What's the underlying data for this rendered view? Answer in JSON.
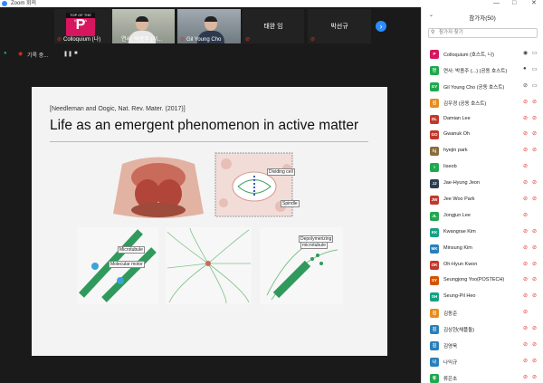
{
  "window": {
    "title": "Zoom 회의",
    "minimize": "—",
    "maximize": "□",
    "close": "✕"
  },
  "gallery": {
    "tiles": [
      {
        "name": "Colloquium (나)",
        "logo_top": "TOP OF THE KOREA",
        "logo_letter": "P"
      },
      {
        "name": "연사: 박종주 (서..."
      },
      {
        "name": "Gil Young Cho"
      },
      {
        "name": "태완 임"
      },
      {
        "name": "박선규"
      }
    ],
    "next_glyph": "›"
  },
  "recording": {
    "label": "기록 중...",
    "pause": "❚❚",
    "stop": "■"
  },
  "slide": {
    "citation": "[Needleman and Oogic, Nat. Rev. Mater. (2017)]",
    "title": "Life as an emergent phenomenon in active matter",
    "labels": {
      "dividing_cell": "Dividing cell",
      "spindle": "Spindle",
      "microtubule": "Microtubule",
      "molecular_motor": "Molecular motor",
      "depolymerizing": "Depolymerizing",
      "depolymerizing2": "microtubule"
    }
  },
  "panel": {
    "title": "참가자(50)",
    "search_placeholder": "참가자 찾기",
    "participants": [
      {
        "initials": "P",
        "name": "Colloquium (호스트, 나)",
        "color": "#d8155f",
        "mic": "◉",
        "cam": "▭"
      },
      {
        "initials": "연",
        "name": "연사: 박종주 (...) (공동 호스트)",
        "color": "#20a84e",
        "mic": "●",
        "cam": "▭"
      },
      {
        "initials": "GY",
        "name": "Gil Young Cho (공동 호스트)",
        "color": "#20a84e",
        "mic": "⊘",
        "cam": "▭"
      },
      {
        "initials": "김",
        "name": "김우경 (공동 호스트)",
        "color": "#e88b1e",
        "mic": "⊘",
        "cam": "⊘"
      },
      {
        "initials": "DL",
        "name": "Damian Lee",
        "color": "#c0392b",
        "mic": "⊘",
        "cam": "⊘"
      },
      {
        "initials": "GO",
        "name": "Gwanuk Oh",
        "color": "#c0392b",
        "mic": "⊘",
        "cam": "⊘"
      },
      {
        "initials": "hj",
        "name": "hyejin park",
        "color": "#8a6d3b",
        "mic": "⊘",
        "cam": "⊘"
      },
      {
        "initials": "I",
        "name": "Iiseob",
        "color": "#20a84e",
        "mic": "⊘",
        "cam": ""
      },
      {
        "initials": "JJ",
        "name": "Jae-Hyung Jeon",
        "color": "#2c3e50",
        "mic": "⊘",
        "cam": "⊘"
      },
      {
        "initials": "JW",
        "name": "Jee Woo Park",
        "color": "#c0392b",
        "mic": "⊘",
        "cam": "⊘"
      },
      {
        "initials": "JL",
        "name": "Jongjun Lee",
        "color": "#20a84e",
        "mic": "⊘",
        "cam": ""
      },
      {
        "initials": "KK",
        "name": "Kwangrae Kim",
        "color": "#16a085",
        "mic": "⊘",
        "cam": "⊘"
      },
      {
        "initials": "MK",
        "name": "Minsung Kim",
        "color": "#2980b9",
        "mic": "⊘",
        "cam": "⊘"
      },
      {
        "initials": "OK",
        "name": "Oh-Hyun Kwon",
        "color": "#c0392b",
        "mic": "⊘",
        "cam": "⊘"
      },
      {
        "initials": "SY",
        "name": "Seungjong Yoo(POSTECH)",
        "color": "#d35400",
        "mic": "⊘",
        "cam": "⊘"
      },
      {
        "initials": "SH",
        "name": "Seung-Pil Heo",
        "color": "#16a085",
        "mic": "⊘",
        "cam": "⊘"
      },
      {
        "initials": "김",
        "name": "김동준",
        "color": "#e88b1e",
        "mic": "⊘",
        "cam": ""
      },
      {
        "initials": "김",
        "name": "김상현(채플돌)",
        "color": "#2980b9",
        "mic": "⊘",
        "cam": "⊘"
      },
      {
        "initials": "김",
        "name": "김영욱",
        "color": "#2980b9",
        "mic": "⊘",
        "cam": "⊘"
      },
      {
        "initials": "나",
        "name": "나익규",
        "color": "#2980b9",
        "mic": "⊘",
        "cam": "⊘"
      },
      {
        "initials": "류",
        "name": "류은초",
        "color": "#20a84e",
        "mic": "⊘",
        "cam": "⊘"
      }
    ]
  }
}
